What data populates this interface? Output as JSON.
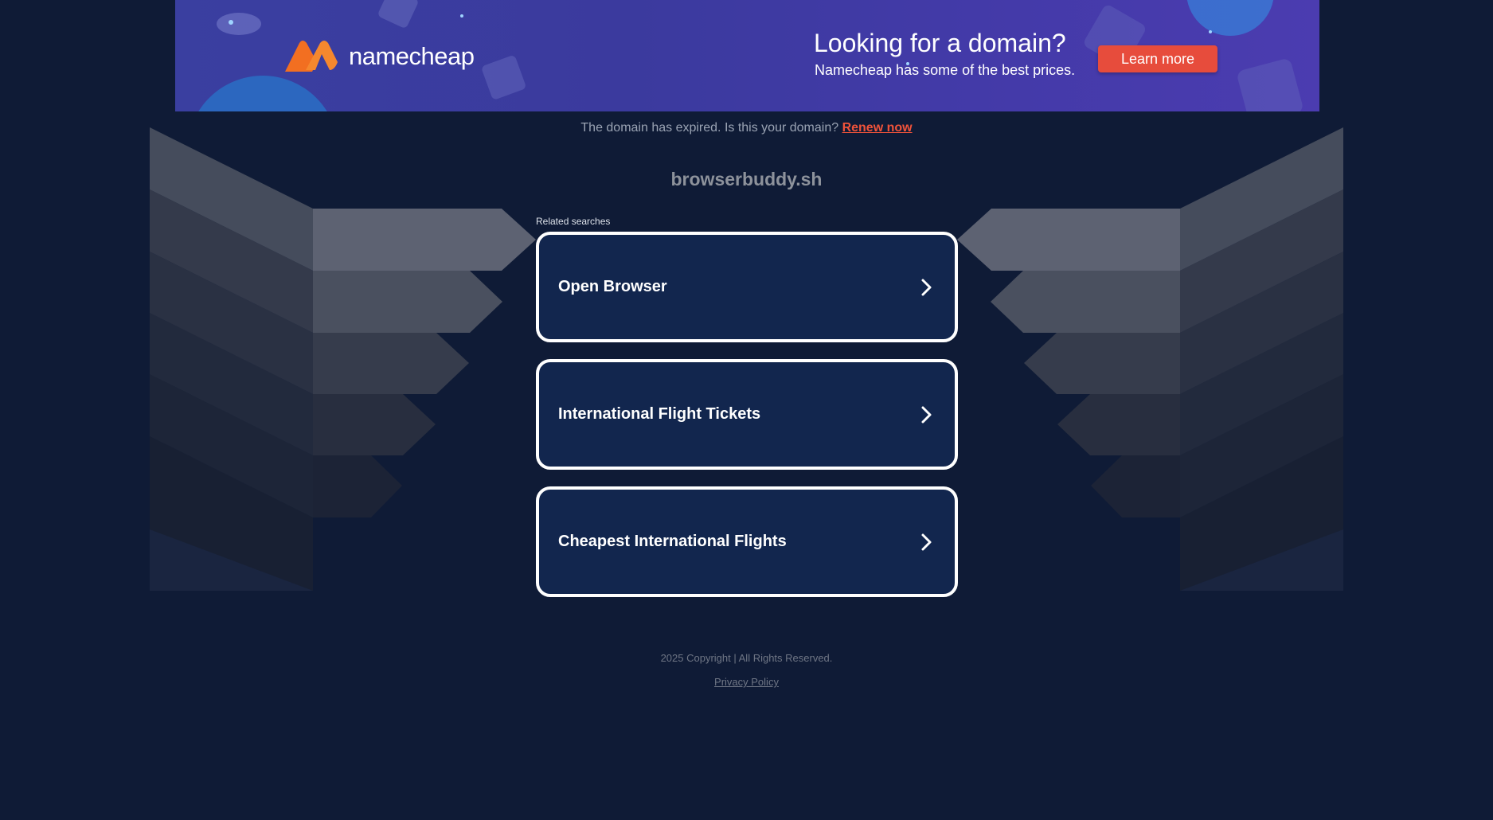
{
  "banner": {
    "brand": "namecheap",
    "headline": "Looking for a domain?",
    "subline": "Namecheap has some of the best prices.",
    "cta_label": "Learn more",
    "logo_icon": "namecheap-logo-icon",
    "colors": {
      "background": "#3b3a9e",
      "logo_orange": "#f26f21",
      "cta": "#e74c3c"
    }
  },
  "notice": {
    "text": "The domain has expired. Is this your domain?",
    "link_label": "Renew now",
    "link_color": "#f0533a"
  },
  "domain": "browserbuddy.sh",
  "related": {
    "label": "Related searches",
    "chevron_icon": "chevron-right-icon",
    "items": [
      {
        "label": "Open Browser"
      },
      {
        "label": "International Flight Tickets"
      },
      {
        "label": "Cheapest International Flights"
      }
    ]
  },
  "footer": {
    "copyright": "2025 Copyright | All Rights Reserved.",
    "privacy_label": "Privacy Policy"
  },
  "colors": {
    "page_background": "#0f1b36",
    "card_background": "#12264e",
    "card_border": "#ffffff"
  }
}
